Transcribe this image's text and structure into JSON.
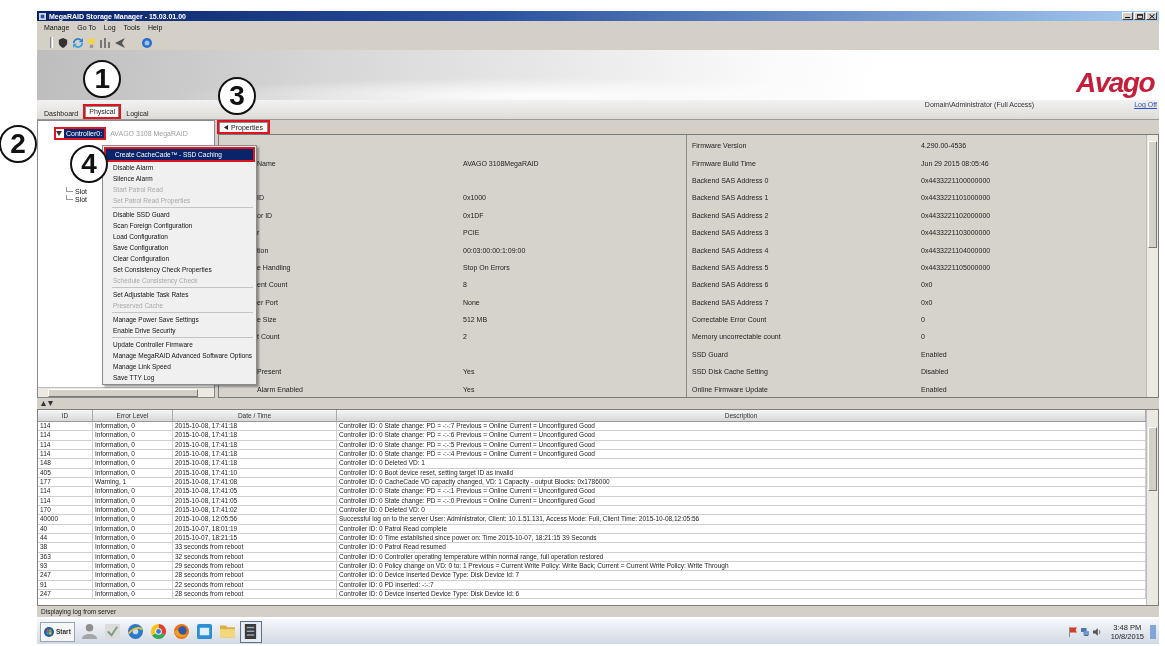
{
  "window": {
    "title": "MegaRAID Storage Manager - 15.03.01.00"
  },
  "menu_bar": [
    "Manage",
    "Go To",
    "Log",
    "Tools",
    "Help"
  ],
  "banner": {
    "logo": "Avago",
    "user": "Domain\\Administrator (Full Access)",
    "log_off": "Log Off"
  },
  "view_tabs": [
    {
      "label": "Dashboard",
      "selected": false
    },
    {
      "label": "Physical",
      "selected": true,
      "callout": "1"
    },
    {
      "label": "Logical",
      "selected": false
    }
  ],
  "tree": {
    "items": [
      {
        "label": "Controller0:",
        "detail": "AVAGO 3108 MegaRAID",
        "selected": true,
        "expanded": true,
        "callout": "2",
        "children": [
          {
            "label": "Slot",
            "selected": false
          },
          {
            "label": "Slot",
            "selected": false
          }
        ]
      }
    ]
  },
  "panel_tabs": [
    {
      "label": "Properties",
      "selected": true,
      "callout": "3"
    }
  ],
  "properties": [
    {
      "right_label": "Firmware Version",
      "right_value": "4.290.00-4536"
    },
    {
      "left_label": "Name",
      "left_value": "AVAGO 3108MegaRAID",
      "right_label": "Firmware Build Time",
      "right_value": "Jun 29 2015 08:05:46"
    },
    {
      "right_label": "Backend SAS Address 0",
      "right_value": "0x4433221100000000"
    },
    {
      "left_label": "ID",
      "left_value": "0x1000",
      "right_label": "Backend SAS Address 1",
      "right_value": "0x4433221101000000"
    },
    {
      "left_label": "or ID",
      "left_value": "0x1DF",
      "right_label": "Backend SAS Address 2",
      "right_value": "0x4433221102000000"
    },
    {
      "left_label": "r",
      "left_value": "PCIE",
      "right_label": "Backend SAS Address 3",
      "right_value": "0x4433221103000000"
    },
    {
      "left_label": "tion",
      "left_value": "00:03:00:00:1:09:00",
      "right_label": "Backend SAS Address 4",
      "right_value": "0x4433221104000000"
    },
    {
      "left_label": "e Handling",
      "left_value": "Stop On Errors",
      "right_label": "Backend SAS Address 5",
      "right_value": "0x4433221105000000"
    },
    {
      "left_label": "ent Count",
      "left_value": "8",
      "right_label": "Backend SAS Address 6",
      "right_value": "0x0"
    },
    {
      "left_label": "er Port",
      "left_value": "None",
      "right_label": "Backend SAS Address 7",
      "right_value": "0x0"
    },
    {
      "left_label": "e Size",
      "left_value": "512 MB",
      "right_label": "Correctable Error Count",
      "right_value": "0"
    },
    {
      "left_label": "t Count",
      "left_value": "2",
      "right_label": "Memory uncorrectable count",
      "right_value": "0"
    },
    {
      "right_label": "SSD Guard",
      "right_value": "Enabled"
    },
    {
      "left_label": "Present",
      "left_value": "Yes",
      "right_label": "SSD Disk Cache Setting",
      "right_value": "Disabled"
    },
    {
      "left_label": "Alarm Enabled",
      "left_value": "Yes",
      "right_label": "Online Firmware Update",
      "right_value": "Enabled"
    }
  ],
  "context_menu": {
    "items": [
      {
        "kind": "item",
        "label": "Create CacheCade™ - SSD Caching",
        "selected": true,
        "disabled": false,
        "callout": "4"
      },
      {
        "kind": "item",
        "label": "Disable Alarm",
        "selected": false,
        "disabled": false
      },
      {
        "kind": "item",
        "label": "Silence Alarm",
        "selected": false,
        "disabled": false
      },
      {
        "kind": "item",
        "label": "Start Patrol Read",
        "selected": false,
        "disabled": true
      },
      {
        "kind": "item",
        "label": "Set Patrol Read Properties",
        "selected": false,
        "disabled": true
      },
      {
        "kind": "separator"
      },
      {
        "kind": "item",
        "label": "Disable SSD Guard",
        "selected": false,
        "disabled": false
      },
      {
        "kind": "item",
        "label": "Scan Foreign Configuration",
        "selected": false,
        "disabled": false
      },
      {
        "kind": "item",
        "label": "Load Configuration",
        "selected": false,
        "disabled": false
      },
      {
        "kind": "item",
        "label": "Save Configuration",
        "selected": false,
        "disabled": false
      },
      {
        "kind": "item",
        "label": "Clear Configuration",
        "selected": false,
        "disabled": false
      },
      {
        "kind": "item",
        "label": "Set Consistency Check Properties",
        "selected": false,
        "disabled": false
      },
      {
        "kind": "item",
        "label": "Schedule Consistency Check",
        "selected": false,
        "disabled": true
      },
      {
        "kind": "separator"
      },
      {
        "kind": "item",
        "label": "Set Adjustable Task Rates",
        "selected": false,
        "disabled": false
      },
      {
        "kind": "item",
        "label": "Preserved Cache",
        "selected": false,
        "disabled": true
      },
      {
        "kind": "separator"
      },
      {
        "kind": "item",
        "label": "Manage Power Save Settings",
        "selected": false,
        "disabled": false
      },
      {
        "kind": "item",
        "label": "Enable Drive Security",
        "selected": false,
        "disabled": false
      },
      {
        "kind": "separator"
      },
      {
        "kind": "item",
        "label": "Update Controller Firmware",
        "selected": false,
        "disabled": false
      },
      {
        "kind": "item",
        "label": "Manage MegaRAID Advanced Software Options",
        "selected": false,
        "disabled": false
      },
      {
        "kind": "item",
        "label": "Manage Link Speed",
        "selected": false,
        "disabled": false
      },
      {
        "kind": "item",
        "label": "Save TTY Log",
        "selected": false,
        "disabled": false
      }
    ]
  },
  "event_log": {
    "columns": [
      "ID",
      "Error Level",
      "Date / Time",
      "Description"
    ],
    "rows": [
      [
        "114",
        "Information, 0",
        "2015-10-08, 17:41:18",
        "Controller ID: 0 State change: PD = -:-:7 Previous = Online Current = Unconfigured Good"
      ],
      [
        "114",
        "Information, 0",
        "2015-10-08, 17:41:18",
        "Controller ID: 0 State change: PD = -:-:6 Previous = Online Current = Unconfigured Good"
      ],
      [
        "114",
        "Information, 0",
        "2015-10-08, 17:41:18",
        "Controller ID: 0 State change: PD = -:-:5 Previous = Online Current = Unconfigured Good"
      ],
      [
        "114",
        "Information, 0",
        "2015-10-08, 17:41:18",
        "Controller ID: 0 State change: PD = -:-:4 Previous = Online Current = Unconfigured Good"
      ],
      [
        "148",
        "Information, 0",
        "2015-10-08, 17:41:18",
        "Controller ID: 0 Deleted VD: 1"
      ],
      [
        "405",
        "Information, 0",
        "2015-10-08, 17:41:10",
        "Controller ID: 0 Boot device reset, setting target ID as invalid"
      ],
      [
        "177",
        "Warning, 1",
        "2015-10-08, 17:41:08",
        "Controller ID: 0 CacheCade VD capacity changed, VD: 1 Capacity - output Blocks: 0x1786000"
      ],
      [
        "114",
        "Information, 0",
        "2015-10-08, 17:41:05",
        "Controller ID: 0 State change: PD = -:-:1 Previous = Online Current = Unconfigured Good"
      ],
      [
        "114",
        "Information, 0",
        "2015-10-08, 17:41:05",
        "Controller ID: 0 State change: PD = -:-:0 Previous = Online Current = Unconfigured Good"
      ],
      [
        "170",
        "Information, 0",
        "2015-10-08, 17:41:02",
        "Controller ID: 0 Deleted VD: 0"
      ],
      [
        "40000",
        "Information, 0",
        "2015-10-08, 12:05:56",
        "Successful log on to the server User: Administrator, Client: 10.1.51.131, Access Mode: Full, Client Time: 2015-10-08,12:05:56"
      ],
      [
        "40",
        "Information, 0",
        "2015-10-07, 18:01:19",
        "Controller ID: 0 Patrol Read complete"
      ],
      [
        "44",
        "Information, 0",
        "2015-10-07, 18:21:15",
        "Controller ID: 0 Time established since power on: Time 2015-10-07, 18:21:15 39 Seconds"
      ],
      [
        "38",
        "Information, 0",
        "33 seconds from reboot",
        "Controller ID: 0 Patrol Read resumed"
      ],
      [
        "363",
        "Information, 0",
        "32 seconds from reboot",
        "Controller ID: 0 Controller operating temperature within normal range, full operation restored"
      ],
      [
        "93",
        "Information, 0",
        "29 seconds from reboot",
        "Controller ID: 0 Policy change on VD: 0 to: 1 Previous = Current Write Policy: Write Back; Current = Current Write Policy: Write Through"
      ],
      [
        "247",
        "Information, 0",
        "28 seconds from reboot",
        "Controller ID: 0 Device inserted Device Type: Disk Device Id: 7"
      ],
      [
        "91",
        "Information, 0",
        "22 seconds from reboot",
        "Controller ID: 0 PD inserted: -:-:7"
      ],
      [
        "247",
        "Information, 0",
        "28 seconds from reboot",
        "Controller ID: 0 Device inserted Device Type: Disk Device Id: 6"
      ]
    ]
  },
  "status_bar": "Displaying log from server",
  "taskbar": {
    "start": "Start",
    "buttons": [
      {
        "active": false
      },
      {
        "active": false
      },
      {
        "active": false
      },
      {
        "active": false
      },
      {
        "active": false
      },
      {
        "active": false
      },
      {
        "active": false
      },
      {
        "active": true
      }
    ],
    "clock": {
      "time": "3:48 PM",
      "date": "10/8/2015"
    }
  }
}
